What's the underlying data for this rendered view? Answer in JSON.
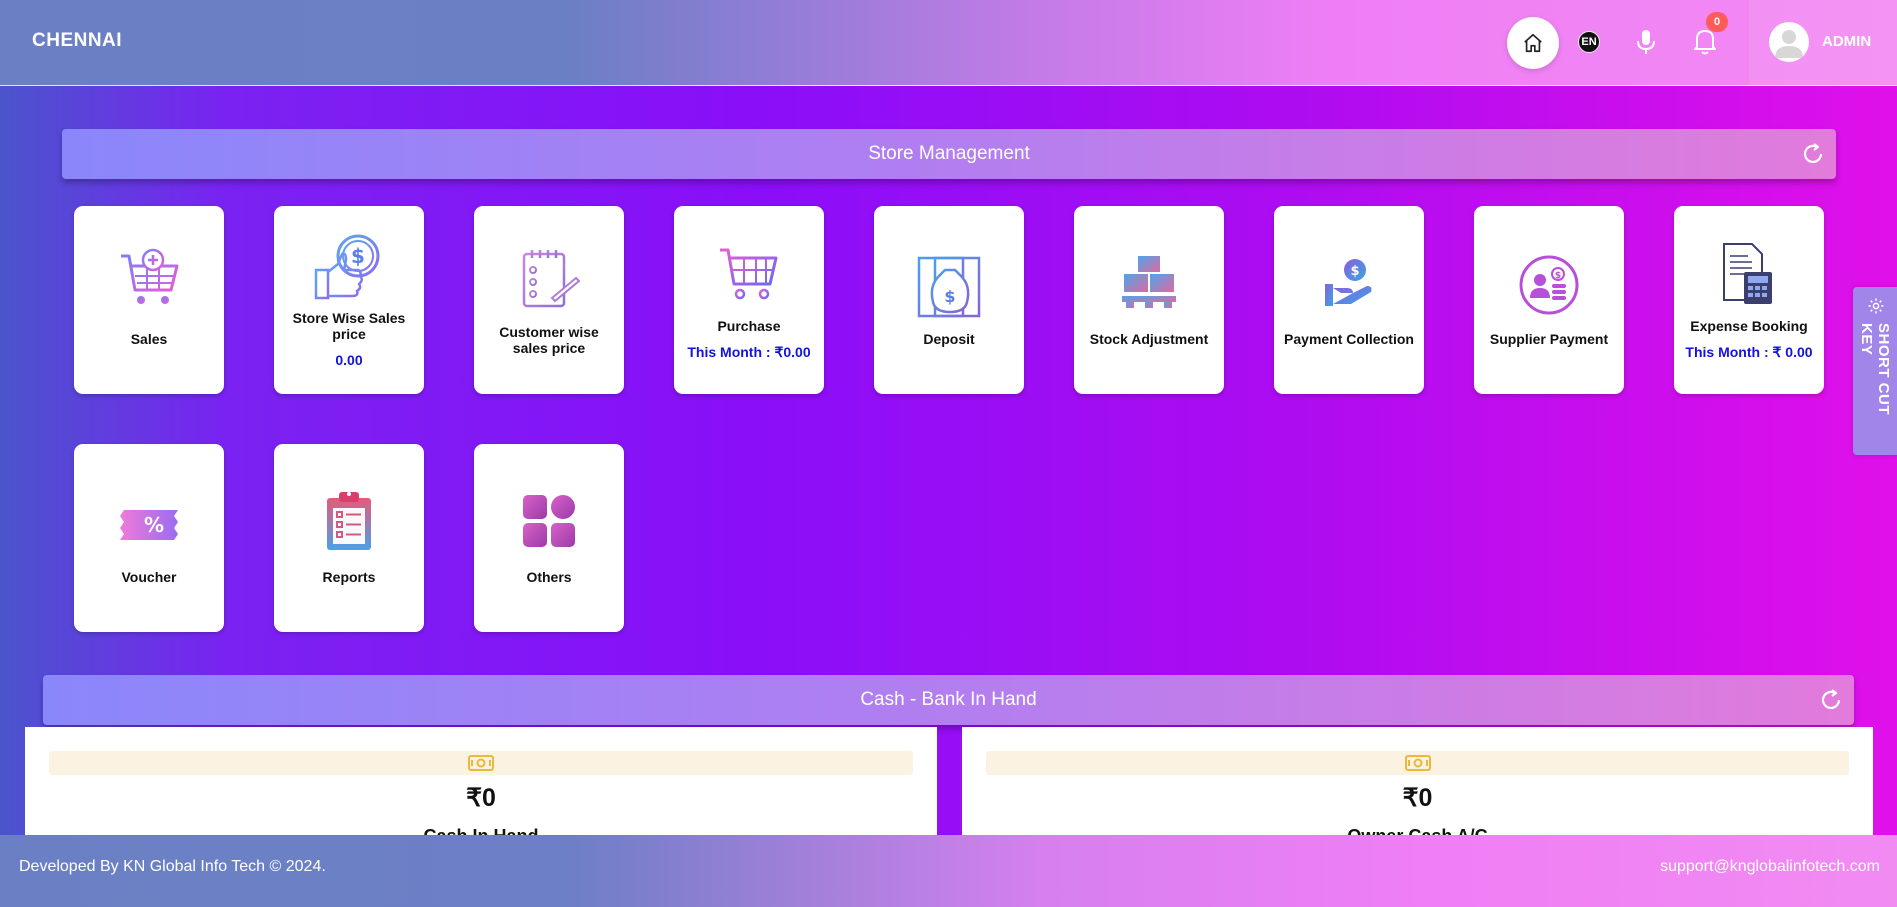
{
  "header": {
    "brand": "CHENNAI",
    "language": "EN",
    "notification_count": "0",
    "user_name": "ADMIN"
  },
  "store_management": {
    "title": "Store Management",
    "tiles": [
      {
        "label": "Sales",
        "icon": "cart-plus-icon"
      },
      {
        "label": "Store Wise Sales price",
        "sub": "0.00",
        "icon": "thumbs-up-dollar-icon"
      },
      {
        "label": "Customer wise sales price",
        "icon": "checklist-icon"
      },
      {
        "label": "Purchase",
        "sub": "This Month : ₹0.00",
        "icon": "cart-icon"
      },
      {
        "label": "Deposit",
        "icon": "money-bag-icon"
      },
      {
        "label": "Stock Adjustment",
        "icon": "boxes-icon"
      },
      {
        "label": "Payment Collection",
        "icon": "hand-coin-icon"
      },
      {
        "label": "Supplier Payment",
        "icon": "supplier-icon"
      },
      {
        "label": "Expense Booking",
        "sub": "This Month : ₹ 0.00",
        "icon": "calculator-doc-icon"
      },
      {
        "label": "Voucher",
        "icon": "voucher-icon"
      },
      {
        "label": "Reports",
        "icon": "clipboard-icon"
      },
      {
        "label": "Others",
        "icon": "grid-icon"
      }
    ]
  },
  "cash_bank": {
    "title": "Cash - Bank In Hand",
    "cards": [
      {
        "amount": "₹0",
        "label": "Cash In Hand"
      },
      {
        "amount": "₹0",
        "label": "Owner Cash A/C"
      }
    ]
  },
  "shortcut_key": "SHORT CUT KEY",
  "footer": {
    "left": "Developed By KN Global Info Tech © 2024.",
    "right": "support@knglobalinfotech.com"
  },
  "colors": {
    "accent_blue": "#1212dd",
    "badge_red": "#ff5b5b"
  }
}
